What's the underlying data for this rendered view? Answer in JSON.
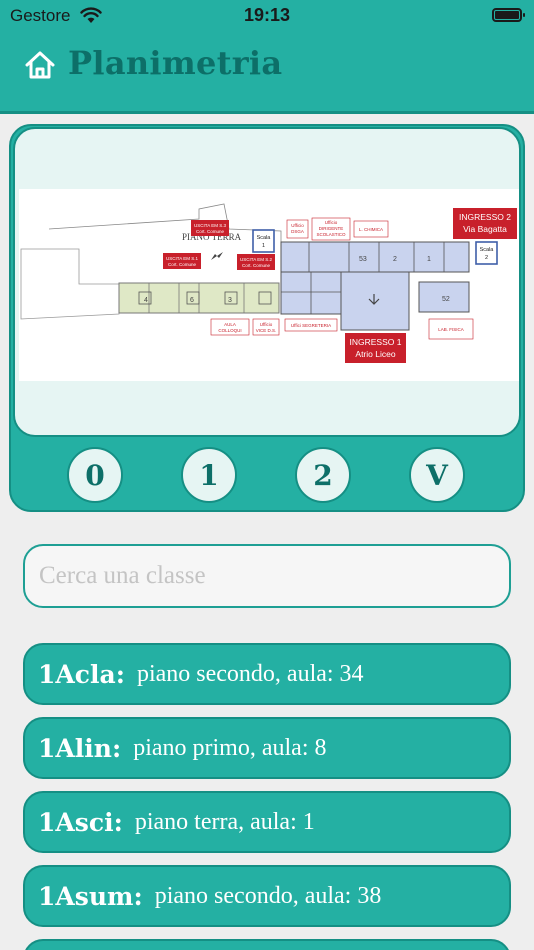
{
  "status_bar": {
    "carrier": "Gestore",
    "time": "19:13"
  },
  "nav": {
    "title": "Planimetria",
    "home_icon": "home-icon"
  },
  "map": {
    "labels": {
      "piano_terra": "PIANO TERRA",
      "scala1": [
        "Scala",
        "1"
      ],
      "scala2": [
        "Scala",
        "2"
      ],
      "uscita_53": [
        "USCITA EM S.3",
        "Cort. Comune"
      ],
      "uscita_51": [
        "USCITA EM S.1",
        "Cort. Comune"
      ],
      "uscita_52": [
        "USCITA EM S.2",
        "Cort. Comune"
      ],
      "uff_dsga": [
        "Ufficio",
        "DSGA"
      ],
      "uff_dirigente": [
        "Ufficio",
        "DIRIGENTE",
        "SCOLASTICO"
      ],
      "lab_chimica": "L. CHIMICA",
      "ingresso2": [
        "INGRESSO 2",
        "Via Bagatta"
      ],
      "ingresso1": [
        "INGRESSO 1",
        "Atrio Liceo"
      ],
      "aula_colloqui": [
        "AULA",
        "COLLOQUI"
      ],
      "uff_vice": [
        "Ufficio",
        "VICE D.S."
      ],
      "uff_segreteria": "Uffici SEGRETERIA",
      "lab_fisica": "LAB. FISICA",
      "rooms": [
        "4",
        "6",
        "3",
        "53",
        "2",
        "1",
        "52"
      ]
    },
    "colors": {
      "east_wing": "#c9d3ee",
      "west_wing": "#dfe8c6",
      "red_label": "#c8202b",
      "blue_box": "#3f5fa8"
    }
  },
  "floors": [
    "0",
    "1",
    "2",
    "V"
  ],
  "search": {
    "placeholder": "Cerca una classe"
  },
  "classes": [
    {
      "code": "1Acla:",
      "desc": "piano secondo, aula: 34"
    },
    {
      "code": "1Alin:",
      "desc": "piano primo, aula: 8"
    },
    {
      "code": "1Asci:",
      "desc": "piano terra, aula: 1"
    },
    {
      "code": "1Asum:",
      "desc": "piano secondo, aula: 38"
    }
  ]
}
